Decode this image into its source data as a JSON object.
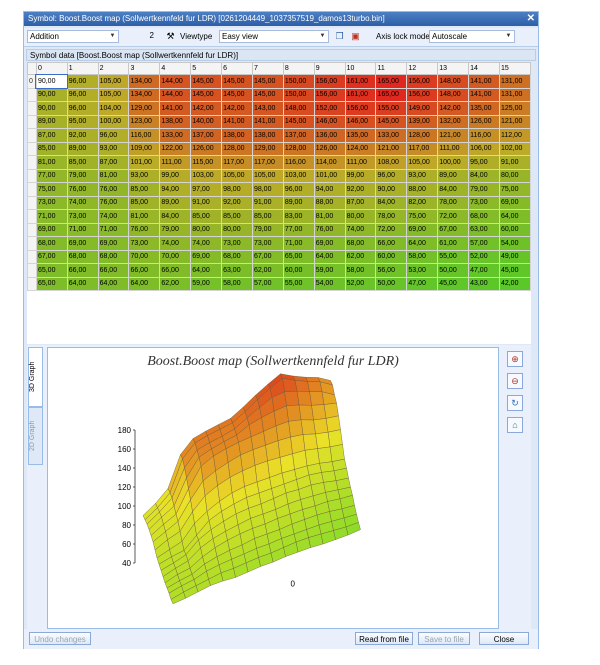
{
  "window": {
    "title": "Symbol: Boost.Boost map (Sollwertkennfeld fur LDR) [0261204449_1037357519_damos13turbo.bin]"
  },
  "toolbar": {
    "operation": "Addition",
    "value": "2",
    "viewtype_label": "Viewtype",
    "viewtype": "Easy view",
    "axis_lock_label": "Axis lock mode",
    "axis_lock": "Autoscale"
  },
  "symbol_data_label": "Symbol data [Boost.Boost map (Sollwertkennfeld fur LDR)]",
  "grid": {
    "columns": [
      "0",
      "1",
      "2",
      "3",
      "4",
      "5",
      "6",
      "7",
      "8",
      "9",
      "10",
      "11",
      "12",
      "13",
      "14",
      "15"
    ],
    "row_label": "0",
    "rows": [
      [
        "90,00",
        "96,00",
        "105,00",
        "134,00",
        "144,00",
        "145,00",
        "145,00",
        "145,00",
        "150,00",
        "156,00",
        "161,00",
        "165,00",
        "156,00",
        "148,00",
        "141,00",
        "131,00"
      ],
      [
        "90,00",
        "96,00",
        "105,00",
        "134,00",
        "144,00",
        "145,00",
        "145,00",
        "145,00",
        "150,00",
        "156,00",
        "161,00",
        "165,00",
        "156,00",
        "148,00",
        "141,00",
        "131,00"
      ],
      [
        "90,00",
        "96,00",
        "104,00",
        "129,00",
        "141,00",
        "142,00",
        "142,00",
        "143,00",
        "148,00",
        "152,00",
        "156,00",
        "155,00",
        "149,00",
        "142,00",
        "135,00",
        "125,00"
      ],
      [
        "89,00",
        "95,00",
        "100,00",
        "123,00",
        "138,00",
        "140,00",
        "141,00",
        "141,00",
        "145,00",
        "146,00",
        "146,00",
        "145,00",
        "139,00",
        "132,00",
        "126,00",
        "121,00"
      ],
      [
        "87,00",
        "92,00",
        "96,00",
        "116,00",
        "133,00",
        "137,00",
        "138,00",
        "138,00",
        "137,00",
        "136,00",
        "135,00",
        "133,00",
        "128,00",
        "121,00",
        "116,00",
        "112,00"
      ],
      [
        "85,00",
        "89,00",
        "93,00",
        "109,00",
        "122,00",
        "126,00",
        "128,00",
        "129,00",
        "128,00",
        "126,00",
        "124,00",
        "121,00",
        "117,00",
        "111,00",
        "106,00",
        "102,00"
      ],
      [
        "81,00",
        "85,00",
        "87,00",
        "101,00",
        "111,00",
        "115,00",
        "117,00",
        "117,00",
        "116,00",
        "114,00",
        "111,00",
        "108,00",
        "105,00",
        "100,00",
        "95,00",
        "91,00"
      ],
      [
        "77,00",
        "79,00",
        "81,00",
        "93,00",
        "99,00",
        "103,00",
        "105,00",
        "105,00",
        "103,00",
        "101,00",
        "99,00",
        "96,00",
        "93,00",
        "89,00",
        "84,00",
        "80,00"
      ],
      [
        "75,00",
        "76,00",
        "76,00",
        "85,00",
        "94,00",
        "97,00",
        "98,00",
        "98,00",
        "96,00",
        "94,00",
        "92,00",
        "90,00",
        "88,00",
        "84,00",
        "79,00",
        "75,00"
      ],
      [
        "73,00",
        "74,00",
        "76,00",
        "85,00",
        "89,00",
        "91,00",
        "92,00",
        "91,00",
        "89,00",
        "88,00",
        "87,00",
        "84,00",
        "82,00",
        "78,00",
        "73,00",
        "69,00"
      ],
      [
        "71,00",
        "73,00",
        "74,00",
        "81,00",
        "84,00",
        "85,00",
        "85,00",
        "85,00",
        "83,00",
        "81,00",
        "80,00",
        "78,00",
        "75,00",
        "72,00",
        "68,00",
        "64,00"
      ],
      [
        "69,00",
        "71,00",
        "71,00",
        "76,00",
        "79,00",
        "80,00",
        "80,00",
        "79,00",
        "77,00",
        "76,00",
        "74,00",
        "72,00",
        "69,00",
        "67,00",
        "63,00",
        "60,00"
      ],
      [
        "68,00",
        "69,00",
        "69,00",
        "73,00",
        "74,00",
        "74,00",
        "73,00",
        "73,00",
        "71,00",
        "69,00",
        "68,00",
        "66,00",
        "64,00",
        "61,00",
        "57,00",
        "54,00"
      ],
      [
        "67,00",
        "68,00",
        "68,00",
        "70,00",
        "70,00",
        "69,00",
        "68,00",
        "67,00",
        "65,00",
        "64,00",
        "62,00",
        "60,00",
        "58,00",
        "55,00",
        "52,00",
        "49,00"
      ],
      [
        "65,00",
        "66,00",
        "66,00",
        "66,00",
        "66,00",
        "64,00",
        "63,00",
        "62,00",
        "60,00",
        "59,00",
        "58,00",
        "56,00",
        "53,00",
        "50,00",
        "47,00",
        "45,00"
      ],
      [
        "65,00",
        "64,00",
        "64,00",
        "64,00",
        "62,00",
        "59,00",
        "58,00",
        "57,00",
        "55,00",
        "54,00",
        "52,00",
        "50,00",
        "47,00",
        "45,00",
        "43,00",
        "42,00"
      ]
    ]
  },
  "graph": {
    "tab_3d": "3D Graph",
    "tab_2d": "2D Graph",
    "title": "Boost.Boost map (Sollwertkennfeld fur LDR)",
    "z_ticks": [
      "180",
      "160",
      "140",
      "120",
      "100",
      "80",
      "60",
      "40"
    ],
    "origin_label": "0"
  },
  "buttons": {
    "undo": "Undo changes",
    "read_from_file": "Read from file",
    "save_to_file": "Save to file",
    "close": "Close"
  },
  "colors": {
    "low": "#66cc33",
    "mid": "#cccc33",
    "high": "#dd3322"
  }
}
